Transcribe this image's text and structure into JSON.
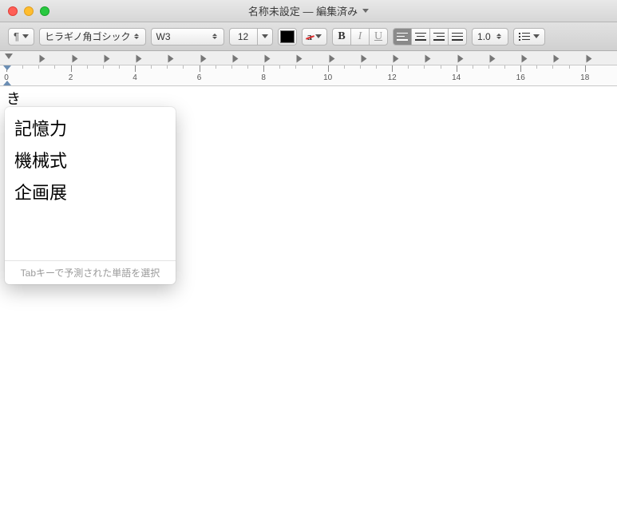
{
  "window": {
    "title": "名称未設定 — 編集済み"
  },
  "toolbar": {
    "pilcrow": "¶",
    "font_family": "ヒラギノ角ゴシック",
    "font_weight": "W3",
    "font_size": "12",
    "text_color": "#000000",
    "bold": "B",
    "italic": "I",
    "underline": "U",
    "line_spacing": "1.0"
  },
  "ruler": {
    "labels": [
      "0",
      "2",
      "4",
      "6",
      "8",
      "10",
      "12",
      "14",
      "16",
      "18"
    ]
  },
  "document": {
    "typed_text": "き"
  },
  "ime": {
    "candidates": [
      "記憶力",
      "機械式",
      "企画展"
    ],
    "hint": "Tabキーで予測された単語を選択"
  }
}
